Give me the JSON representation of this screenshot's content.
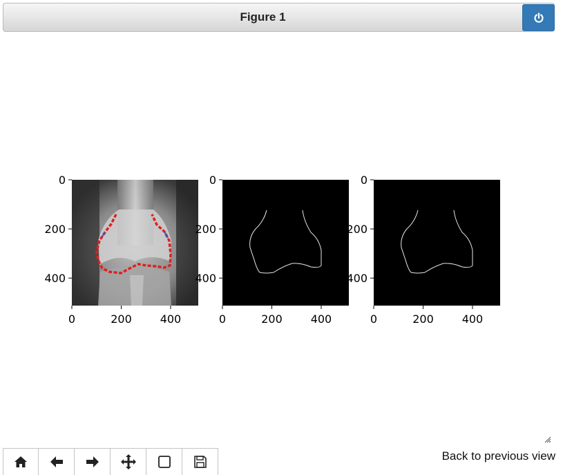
{
  "window": {
    "title": "Figure 1"
  },
  "toolbar_buttons": [
    {
      "icon": "home-icon",
      "label": "Home"
    },
    {
      "icon": "back-arrow-icon",
      "label": "Back"
    },
    {
      "icon": "forward-arrow-icon",
      "label": "Forward"
    },
    {
      "icon": "pan-icon",
      "label": "Pan"
    },
    {
      "icon": "zoom-rect-icon",
      "label": "Zoom"
    },
    {
      "icon": "save-icon",
      "label": "Save"
    }
  ],
  "status": {
    "message": "Back to previous view"
  },
  "chart_data": [
    {
      "type": "image",
      "content": "knee x-ray with red contour overlay",
      "x_ticks": [
        "0",
        "200",
        "400"
      ],
      "y_ticks": [
        "0",
        "200",
        "400"
      ],
      "xlim": [
        0,
        512
      ],
      "ylim": [
        512,
        0
      ]
    },
    {
      "type": "image",
      "content": "extracted bone edge contour (black background)",
      "x_ticks": [
        "0",
        "200",
        "400"
      ],
      "y_ticks": [
        "0",
        "200",
        "400"
      ],
      "xlim": [
        0,
        512
      ],
      "ylim": [
        512,
        0
      ]
    },
    {
      "type": "image",
      "content": "extracted bone edge contour (black background)",
      "x_ticks": [
        "0",
        "200",
        "400"
      ],
      "y_ticks": [
        "0",
        "200",
        "400"
      ],
      "xlim": [
        0,
        512
      ],
      "ylim": [
        512,
        0
      ]
    }
  ]
}
